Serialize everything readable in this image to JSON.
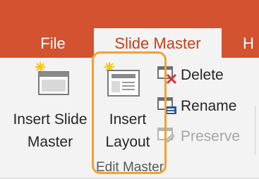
{
  "tabs": {
    "file": "File",
    "active": "Slide Master",
    "next_partial": "H"
  },
  "ribbon": {
    "insert_slide_master": {
      "line1": "Insert Slide",
      "line2": "Master"
    },
    "insert_layout": {
      "line1": "Insert",
      "line2": "Layout"
    },
    "delete": "Delete",
    "rename": "Rename",
    "preserve": "Preserve",
    "group_label": "Edit Master"
  },
  "colors": {
    "accent": "#d35230",
    "active_tab_text": "#c43e1c",
    "highlight": "#f0a233"
  }
}
